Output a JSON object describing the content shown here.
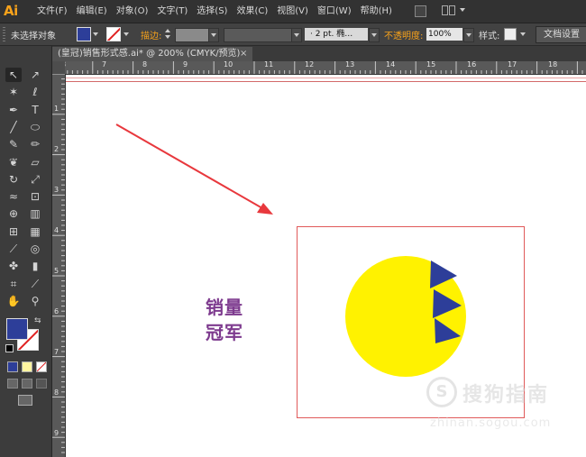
{
  "app": {
    "logo": "Ai",
    "menu": [
      "文件(F)",
      "编辑(E)",
      "对象(O)",
      "文字(T)",
      "选择(S)",
      "效果(C)",
      "视图(V)",
      "窗口(W)",
      "帮助(H)"
    ]
  },
  "control_bar": {
    "selection_status": "未选择对象",
    "stroke_label": "描边:",
    "brush_value": "· 2 pt. 椭…",
    "opacity_label": "不透明度:",
    "opacity_value": "100%",
    "style_label": "样式:",
    "doc_setup_label": "文档设置",
    "fill_color": "#2d3e99",
    "stroke_swatch": "none"
  },
  "document_tab": {
    "title": "(皇冠)销售形式感.ai* @ 200% (CMYK/预览)",
    "close_glyph": "×"
  },
  "rulers": {
    "top_labels": [
      "8",
      "7",
      "8",
      "9",
      "10",
      "11",
      "12",
      "13",
      "14",
      "15",
      "16",
      "17",
      "18"
    ],
    "left_labels": [
      "1",
      "2",
      "3",
      "4",
      "5",
      "6",
      "7",
      "8",
      "9"
    ]
  },
  "canvas": {
    "caption_lines": [
      "销量",
      "冠军"
    ],
    "circle_color": "#fff200",
    "triangle_color": "#2d3e99",
    "arrow_color": "#e8383d",
    "frame_color": "#e05a5a"
  },
  "watermark": {
    "logo_glyph": "S",
    "title": "搜狗指南",
    "url": "zhinan.sogou.com"
  },
  "tools": [
    {
      "name": "selection-tool-icon",
      "glyph": "↖"
    },
    {
      "name": "direct-selection-tool-icon",
      "glyph": "↗"
    },
    {
      "name": "magic-wand-tool-icon",
      "glyph": "✶"
    },
    {
      "name": "lasso-tool-icon",
      "glyph": "ℓ"
    },
    {
      "name": "pen-tool-icon",
      "glyph": "✒"
    },
    {
      "name": "type-tool-icon",
      "glyph": "T"
    },
    {
      "name": "line-segment-tool-icon",
      "glyph": "╱"
    },
    {
      "name": "ellipse-tool-icon",
      "glyph": "⬭"
    },
    {
      "name": "paintbrush-tool-icon",
      "glyph": "✎"
    },
    {
      "name": "pencil-tool-icon",
      "glyph": "✏"
    },
    {
      "name": "blob-brush-tool-icon",
      "glyph": "❦"
    },
    {
      "name": "eraser-tool-icon",
      "glyph": "▱"
    },
    {
      "name": "rotate-tool-icon",
      "glyph": "↻"
    },
    {
      "name": "scale-tool-icon",
      "glyph": "⤢"
    },
    {
      "name": "width-tool-icon",
      "glyph": "≈"
    },
    {
      "name": "free-transform-tool-icon",
      "glyph": "⊡"
    },
    {
      "name": "shape-builder-tool-icon",
      "glyph": "⊕"
    },
    {
      "name": "graph-tool-icon",
      "glyph": "▥"
    },
    {
      "name": "mesh-tool-icon",
      "glyph": "⊞"
    },
    {
      "name": "gradient-tool-icon",
      "glyph": "▦"
    },
    {
      "name": "eyedropper-tool-icon",
      "glyph": "⟋"
    },
    {
      "name": "blend-tool-icon",
      "glyph": "◎"
    },
    {
      "name": "symbol-sprayer-tool-icon",
      "glyph": "✤"
    },
    {
      "name": "column-graph-tool-icon",
      "glyph": "▮"
    },
    {
      "name": "artboard-tool-icon",
      "glyph": "⌗"
    },
    {
      "name": "slice-tool-icon",
      "glyph": "⟋"
    },
    {
      "name": "hand-tool-icon",
      "glyph": "✋"
    },
    {
      "name": "zoom-tool-icon",
      "glyph": "⚲"
    }
  ]
}
